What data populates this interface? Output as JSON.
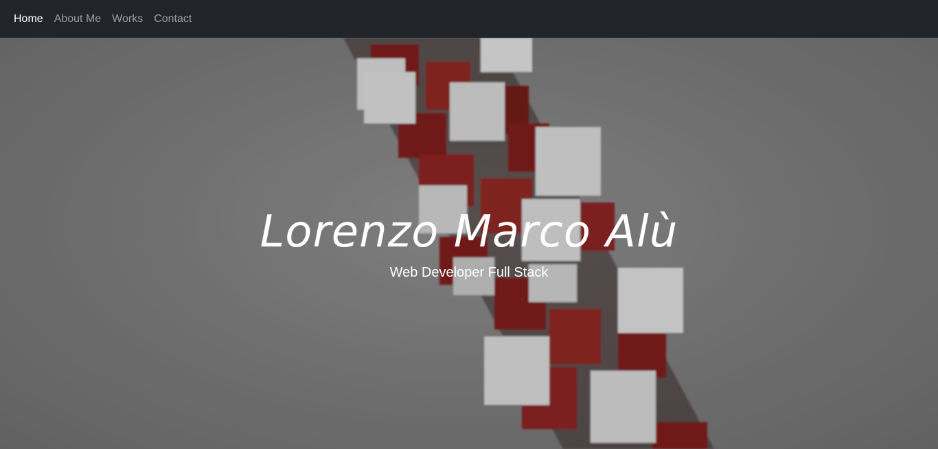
{
  "nav": {
    "items": [
      {
        "label": "Home",
        "active": true
      },
      {
        "label": "About Me",
        "active": false
      },
      {
        "label": "Works",
        "active": false
      },
      {
        "label": "Contact",
        "active": false
      }
    ]
  },
  "hero": {
    "title": "Lorenzo Marco Alù",
    "subtitle": "Web Developer Full Stack"
  },
  "colors": {
    "navbar_bg": "#212529",
    "nav_active": "#ffffff",
    "nav_inactive": "rgba(255,255,255,0.55)",
    "cube_red": "#7a1f1b",
    "cube_white": "#cfcfcf"
  }
}
